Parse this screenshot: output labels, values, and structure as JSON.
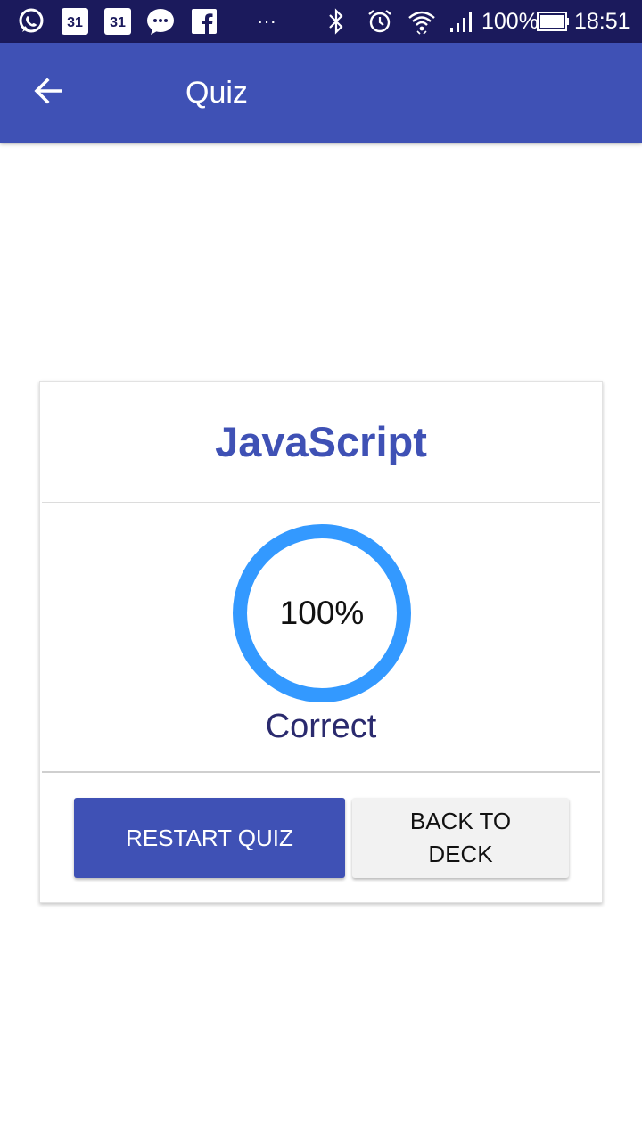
{
  "status_bar": {
    "calendar_day_1": "31",
    "calendar_day_2": "31",
    "more_dots": "···",
    "battery": "100%",
    "time": "18:51"
  },
  "app_bar": {
    "title": "Quiz"
  },
  "card": {
    "deck_name": "JavaScript",
    "score_text": "100%",
    "score_fraction": 1.0,
    "result_label": "Correct",
    "restart_label": "RESTART QUIZ",
    "back_label": "BACK TO DECK"
  },
  "colors": {
    "primary": "#3f51b5",
    "status_bar": "#1b1a5c",
    "progress": "#3399ff"
  }
}
